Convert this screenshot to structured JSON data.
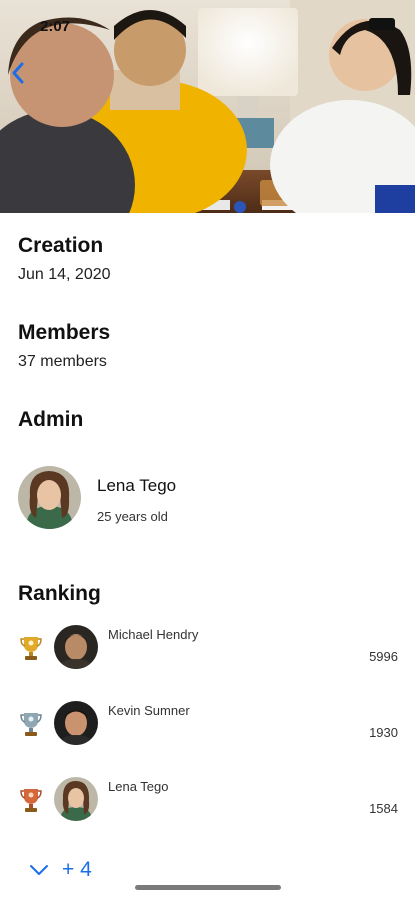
{
  "status_bar": {
    "time": "2:07"
  },
  "header": {
    "back_icon": "chevron-left-icon"
  },
  "creation": {
    "title": "Creation",
    "value": "Jun 14, 2020"
  },
  "members": {
    "title": "Members",
    "value": "37 members"
  },
  "admin": {
    "title": "Admin",
    "name": "Lena Tego",
    "age": "25 years old"
  },
  "ranking": {
    "title": "Ranking",
    "items": [
      {
        "name": "Michael Hendry",
        "score": "5996",
        "trophy": "gold-trophy-icon",
        "trophy_color": "#e0a92a"
      },
      {
        "name": "Kevin Sumner",
        "score": "1930",
        "trophy": "silver-trophy-icon",
        "trophy_color": "#8fa7b3"
      },
      {
        "name": "Lena Tego",
        "score": "1584",
        "trophy": "bronze-trophy-icon",
        "trophy_color": "#d4683a"
      }
    ],
    "more_label": "+ 4"
  },
  "colors": {
    "accent": "#1a6fe8"
  }
}
